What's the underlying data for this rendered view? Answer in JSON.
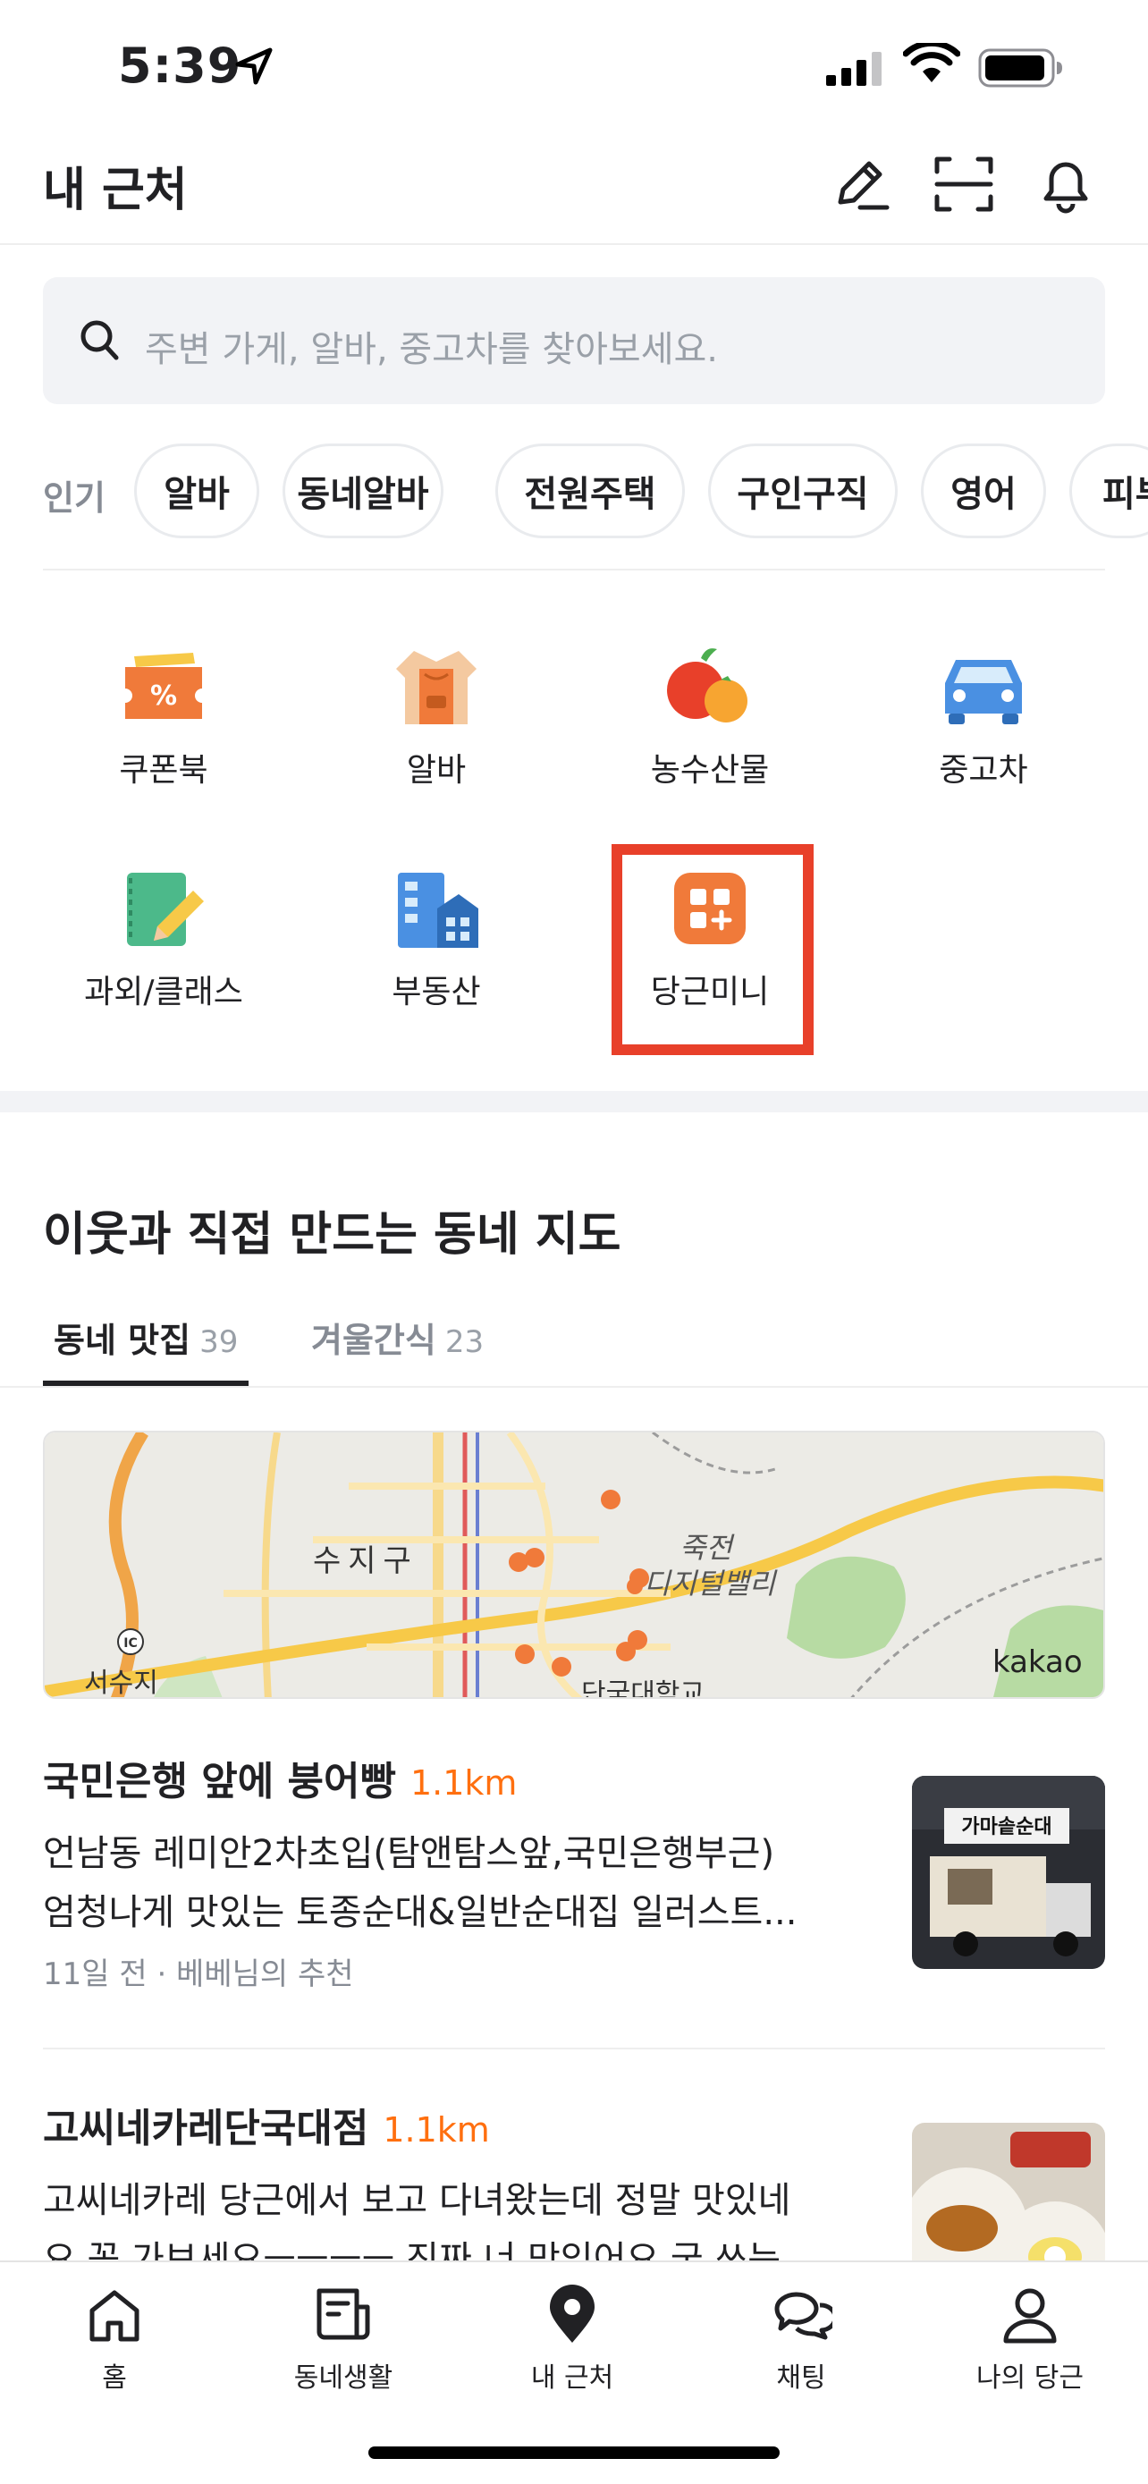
{
  "status_bar": {
    "time": "5:39"
  },
  "header": {
    "title": "내 근처",
    "icons": [
      "edit-icon",
      "scan-icon",
      "bell-icon"
    ]
  },
  "search": {
    "placeholder": "주변 가게, 알바, 중고차를 찾아보세요."
  },
  "popular": {
    "label": "인기",
    "chips": [
      "알바",
      "동네알바",
      "전원주택",
      "구인구직",
      "영어",
      "피부"
    ]
  },
  "categories": [
    {
      "label": "쿠폰북",
      "icon": "coupon-icon"
    },
    {
      "label": "알바",
      "icon": "apron-icon"
    },
    {
      "label": "농수산물",
      "icon": "fruit-icon"
    },
    {
      "label": "중고차",
      "icon": "car-icon"
    },
    {
      "label": "과외/클래스",
      "icon": "notebook-icon"
    },
    {
      "label": "부동산",
      "icon": "building-icon"
    },
    {
      "label": "당근미니",
      "icon": "mini-app-icon"
    }
  ],
  "map_section": {
    "title": "이웃과 직접 만드는 동네 지도",
    "tabs": [
      {
        "label": "동네 맛집",
        "count": "39",
        "active": true
      },
      {
        "label": "겨울간식",
        "count": "23",
        "active": false
      }
    ],
    "map_labels": {
      "district": "수지구",
      "area": "죽전",
      "area2": "디지털밸리",
      "west": "서수지",
      "station": "단국대학교",
      "ic": "IC",
      "brand": "kakao"
    }
  },
  "posts": [
    {
      "title": "국민은행 앞에 붕어빵",
      "distance": "1.1km",
      "line1": "언남동 레미안2차초입(탐앤탐스앞,국민은행부근)",
      "line2": "엄청나게 맛있는 토종순대&일반순대집 일러스트...",
      "meta": "11일 전 · 베베님의 추천",
      "thumb_sign": "가마솥순대"
    },
    {
      "title": "고씨네카레단국대점",
      "distance": "1.1km",
      "line1": "고씨네카레 당근에서 보고 다녀왔는데 정말 맛있네",
      "line2": "요 꼭 가보세요ㅡㅡㅡㅡ 진짜 너 맛있어요 국 쓰는"
    }
  ],
  "bottom_nav": [
    {
      "label": "홈",
      "icon": "home-icon"
    },
    {
      "label": "동네생활",
      "icon": "newspaper-icon"
    },
    {
      "label": "내 근처",
      "icon": "location-pin-icon",
      "active": true
    },
    {
      "label": "채팅",
      "icon": "chat-icon"
    },
    {
      "label": "나의 당근",
      "icon": "person-icon"
    }
  ],
  "colors": {
    "accent": "#ff6f0f",
    "highlight": "#e8402a",
    "text": "#212124",
    "muted": "#868b94"
  }
}
